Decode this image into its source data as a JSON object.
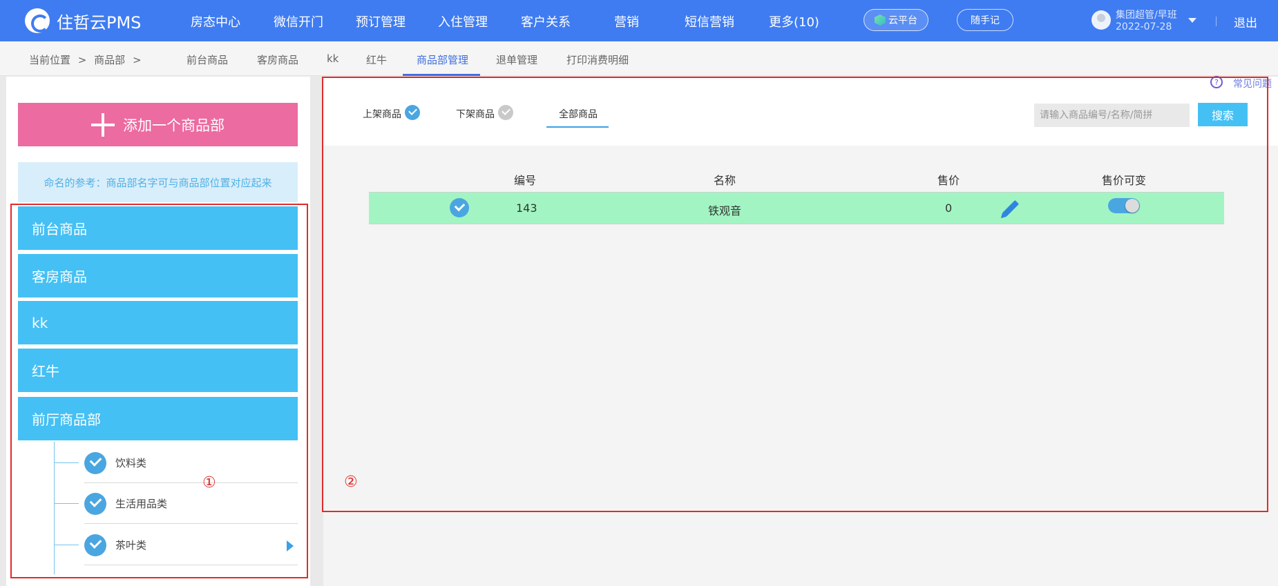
{
  "app": {
    "brand": "住哲云PMS"
  },
  "topnav": {
    "items": [
      "房态中心",
      "微信开门",
      "预订管理",
      "入住管理",
      "客户关系",
      "营销",
      "短信营销",
      "更多(10)"
    ],
    "cloud_label": "云平台",
    "note_label": "随手记",
    "user_name": "集团超管/早班",
    "user_date": "2022-07-28",
    "logout": "退出"
  },
  "subnav": {
    "breadcrumb": [
      "当前位置",
      ">",
      "商品部",
      ">"
    ],
    "tabs": [
      "前台商品",
      "客房商品",
      "kk",
      "红牛",
      "商品部管理",
      "退单管理",
      "打印消费明细"
    ],
    "active_tab": "商品部管理"
  },
  "left": {
    "add_label": "添加一个商品部",
    "tip": "命名的参考：商品部名字可与商品部位置对应起来",
    "categories": [
      "前台商品",
      "客房商品",
      "kk",
      "红牛",
      "前厅商品部"
    ],
    "subcategories": [
      "饮料类",
      "生活用品类",
      "茶叶类"
    ],
    "marker": "①"
  },
  "right": {
    "faq_icon": "?",
    "faq": "常见问题",
    "filters": [
      "上架商品",
      "下架商品",
      "全部商品"
    ],
    "active_filter": "全部商品",
    "search_placeholder": "请输入商品编号/名称/简拼",
    "search_button": "搜索",
    "columns": [
      "编号",
      "名称",
      "售价",
      "售价可变"
    ],
    "rows": [
      {
        "id": "143",
        "name": "铁观音",
        "price": "0",
        "price_variable": true,
        "checked": true
      }
    ],
    "marker": "②"
  },
  "colors": {
    "brand": "#3f7cf1",
    "add_button": "#ec6ba1",
    "category": "#45c0f4",
    "row_highlight": "#a2f5c2",
    "annotation": "#e12a2a"
  }
}
